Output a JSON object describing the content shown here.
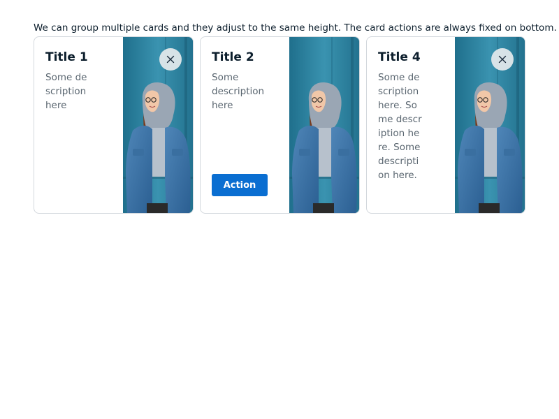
{
  "intro_text": "We can group multiple cards and they adjust to the same height. The card actions are always fixed on bottom.",
  "colors": {
    "primary": "#0a6ed1",
    "text": "#0c1e2c",
    "muted_text": "#5a6670",
    "card_border": "#d3d8dd",
    "photo_background": "#2d7f9c"
  },
  "cards": [
    {
      "title": "Title 1",
      "description": "Some description here",
      "has_close": true,
      "close_icon": "close-icon",
      "image": "woman-in-denim-jacket-photo"
    },
    {
      "title": "Title 2",
      "description": "Some description here",
      "has_close": false,
      "action_label": "Action",
      "image": "woman-in-denim-jacket-photo"
    },
    {
      "title": "Title 4",
      "description": "Some description here. Some description here. Some description here.",
      "has_close": true,
      "close_icon": "close-icon",
      "image": "woman-in-denim-jacket-photo"
    }
  ]
}
